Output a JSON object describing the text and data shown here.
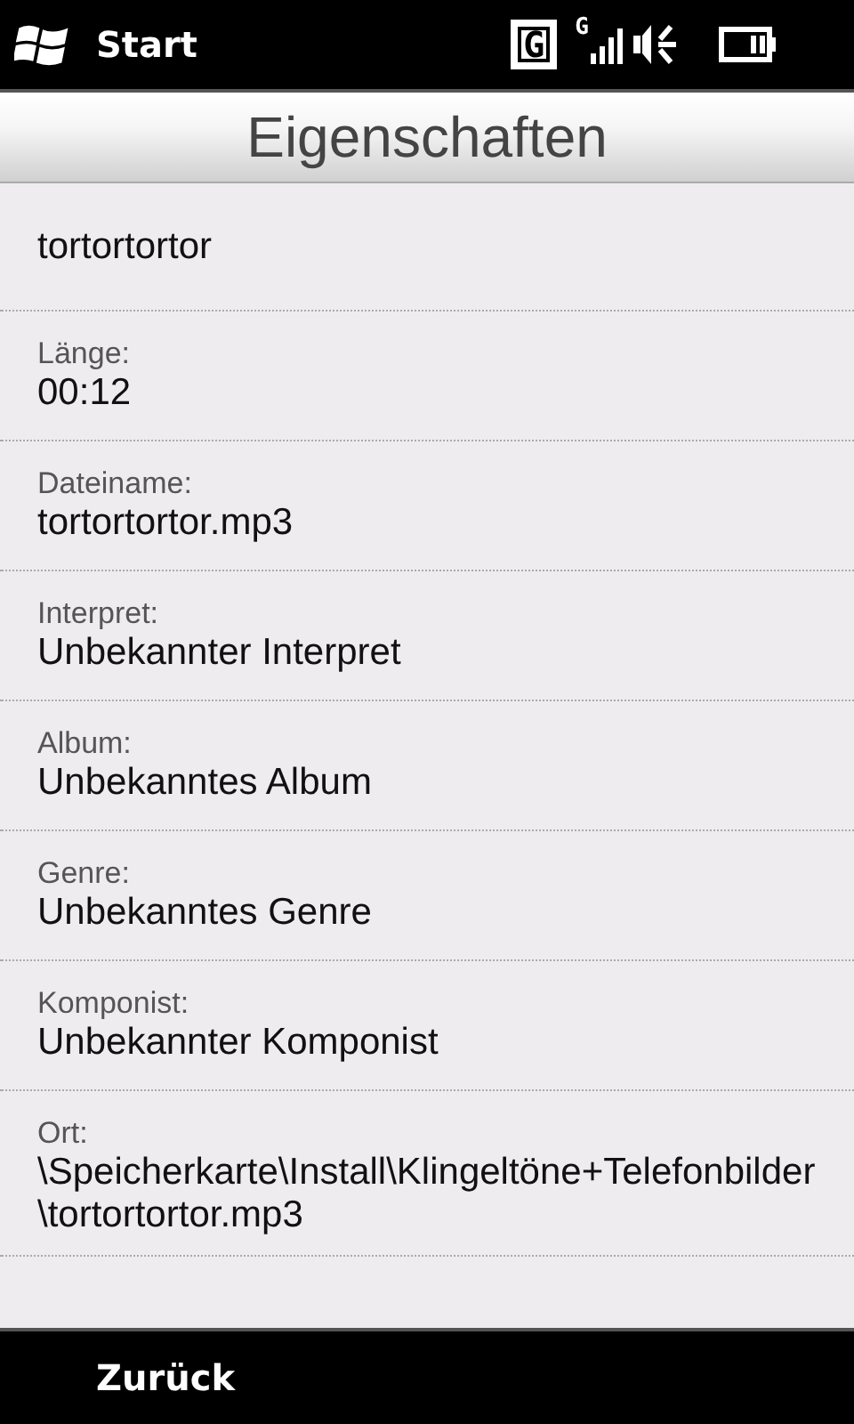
{
  "status_bar": {
    "start": "Start",
    "network": "G",
    "signal_type": "G"
  },
  "header": {
    "title": "Eigenschaften"
  },
  "name": "tortortortor",
  "properties": [
    {
      "label": "Länge:",
      "value": "00:12"
    },
    {
      "label": "Dateiname:",
      "value": "tortortortor.mp3"
    },
    {
      "label": "Interpret:",
      "value": "Unbekannter Interpret"
    },
    {
      "label": "Album:",
      "value": "Unbekanntes Album"
    },
    {
      "label": "Genre:",
      "value": "Unbekanntes Genre"
    },
    {
      "label": "Komponist:",
      "value": "Unbekannter Komponist"
    },
    {
      "label": "Ort:",
      "value": "\\Speicherkarte\\Install\\Klingeltöne+Telefonbilder\\tortortortor.mp3"
    }
  ],
  "softkeys": {
    "left": "Zurück"
  }
}
